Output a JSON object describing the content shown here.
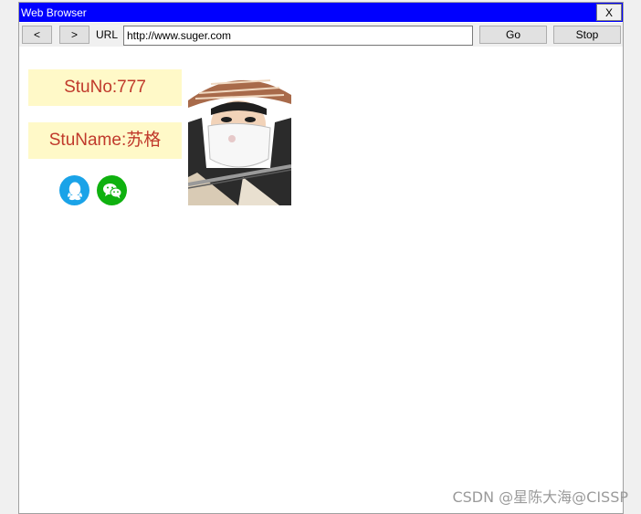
{
  "window": {
    "title": "Web Browser",
    "close_label": "X"
  },
  "toolbar": {
    "back_label": "<",
    "forward_label": ">",
    "url_label": "URL",
    "url_value": "http://www.suger.com",
    "go_label": "Go",
    "stop_label": "Stop"
  },
  "page": {
    "stu_no": "StuNo:777",
    "stu_name": "StuName:苏格",
    "social_icons": [
      "qq-icon",
      "wechat-icon"
    ],
    "colors": {
      "label_bg": "#fff9c8",
      "label_text": "#c0392b",
      "qq": "#1aa3e8",
      "wechat": "#0fb10f"
    }
  },
  "watermark": "CSDN @星陈大海@CISSP"
}
